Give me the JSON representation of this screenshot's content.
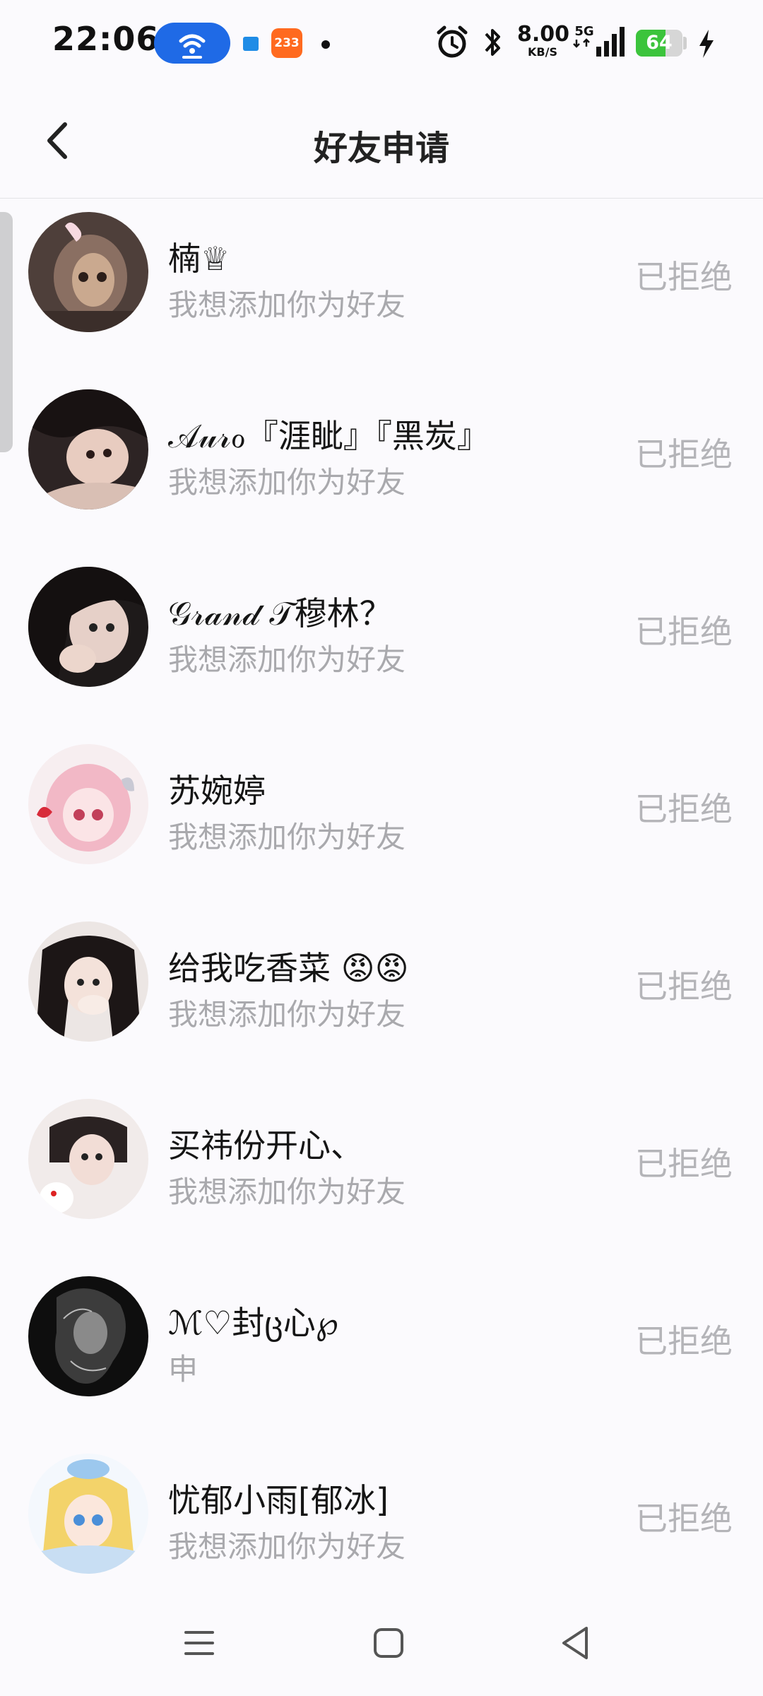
{
  "status_bar": {
    "time": "22:06",
    "notification_badge": "233",
    "net_speed_value": "8.00",
    "net_speed_unit": "KB/S",
    "network_type": "5G",
    "battery_level": "64",
    "icons": [
      "wifi-icon",
      "alarm-icon",
      "bluetooth-icon",
      "signal-icon",
      "battery-icon",
      "charging-icon"
    ]
  },
  "header": {
    "title": "好友申请",
    "back_icon": "chevron-left-icon"
  },
  "requests": [
    {
      "name": "楠♕",
      "message": "我想添加你为好友",
      "status": "已拒绝",
      "avatar_color": "#5a4a44"
    },
    {
      "name": "𝒜𝓊𝓇ℴ『涯眦』『黑炭』",
      "message": "我想添加你为好友",
      "status": "已拒绝",
      "avatar_color": "#3a2f2f"
    },
    {
      "name": "𝒢𝓇𝒶𝓃𝒹 𝒯穆林？",
      "message": "我想添加你为好友",
      "status": "已拒绝",
      "avatar_color": "#2d2929"
    },
    {
      "name": "苏婉婷",
      "message": "我想添加你为好友",
      "status": "已拒绝",
      "avatar_color": "#f3c6cf"
    },
    {
      "name": "给我吃香菜 😡😡",
      "message": "我想添加你为好友",
      "status": "已拒绝",
      "avatar_color": "#d9d2d0"
    },
    {
      "name": "买祎份开心、",
      "message": "我想添加你为好友",
      "status": "已拒绝",
      "avatar_color": "#e8dede"
    },
    {
      "name": "ℳ♡封ც心℘",
      "message": "申",
      "status": "已拒绝",
      "avatar_color": "#1a1a1a"
    },
    {
      "name": "忧郁小雨[郁冰]",
      "message": "我想添加你为好友",
      "status": "已拒绝",
      "avatar_color": "#cfe3f5"
    }
  ],
  "nav_bar": {
    "icons": [
      "menu-icon",
      "home-icon",
      "back-triangle-icon"
    ]
  },
  "colors": {
    "background": "#fbfafd",
    "status_text": "#b4b4b8",
    "message_text": "#a9a9ad",
    "wifi_pill": "#1f6ae6",
    "battery_green": "#3cc43c"
  }
}
